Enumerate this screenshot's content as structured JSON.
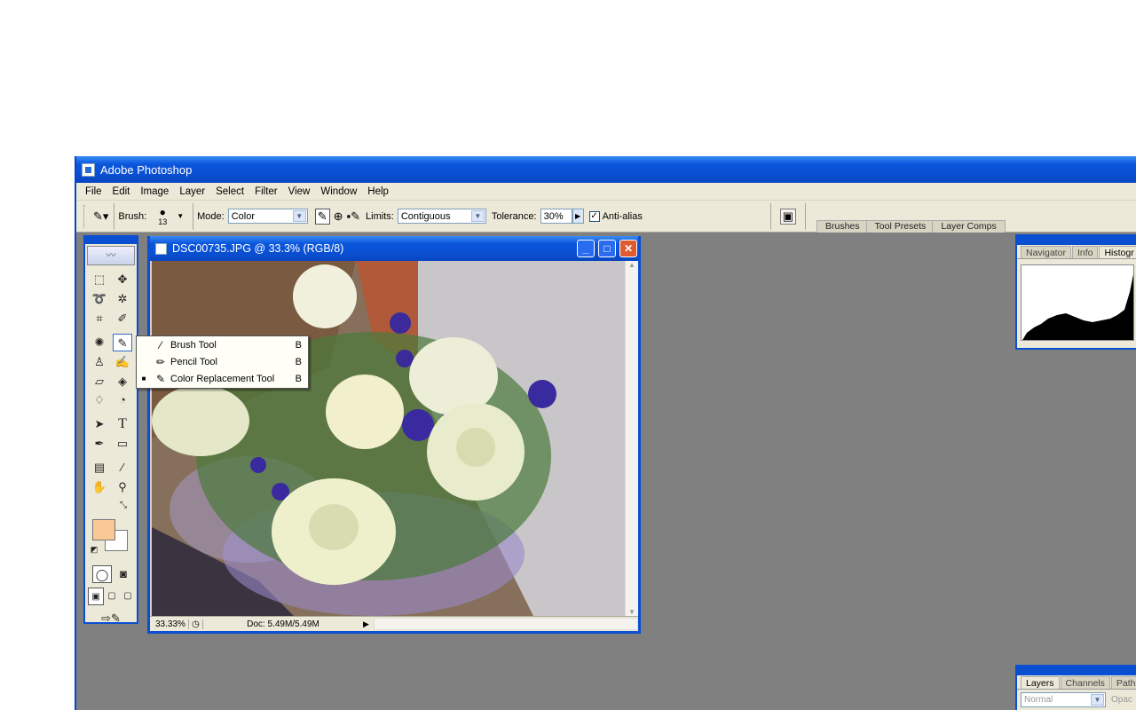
{
  "app": {
    "title": "Adobe Photoshop"
  },
  "menu": [
    "File",
    "Edit",
    "Image",
    "Layer",
    "Select",
    "Filter",
    "View",
    "Window",
    "Help"
  ],
  "options": {
    "brush_label": "Brush:",
    "brush_size": "13",
    "mode_label": "Mode:",
    "mode_value": "Color",
    "limits_label": "Limits:",
    "limits_value": "Contiguous",
    "tolerance_label": "Tolerance:",
    "tolerance_value": "30%",
    "antialias_label": "Anti-alias",
    "antialias_checked": true
  },
  "wells": [
    "Brushes",
    "Tool Presets",
    "Layer Comps"
  ],
  "document": {
    "title": "DSC00735.JPG @ 33.3% (RGB/8)",
    "zoom": "33.33%",
    "doc_info": "Doc: 5.49M/5.49M"
  },
  "flyout": [
    {
      "label": "Brush Tool",
      "key": "B",
      "selected": false,
      "icon": "brush-icon"
    },
    {
      "label": "Pencil Tool",
      "key": "B",
      "selected": false,
      "icon": "pencil-icon"
    },
    {
      "label": "Color Replacement Tool",
      "key": "B",
      "selected": true,
      "icon": "color-replacement-icon"
    }
  ],
  "panels": {
    "top_tabs": [
      "Navigator",
      "Info",
      "Histogr"
    ],
    "bottom_tabs": [
      "Layers",
      "Channels",
      "Paths"
    ],
    "blend_mode": "Normal",
    "opacity_label": "Opac"
  },
  "colors": {
    "foreground": "#f9c896",
    "background": "#ffffff",
    "title_blue": "#0a4fd2"
  }
}
